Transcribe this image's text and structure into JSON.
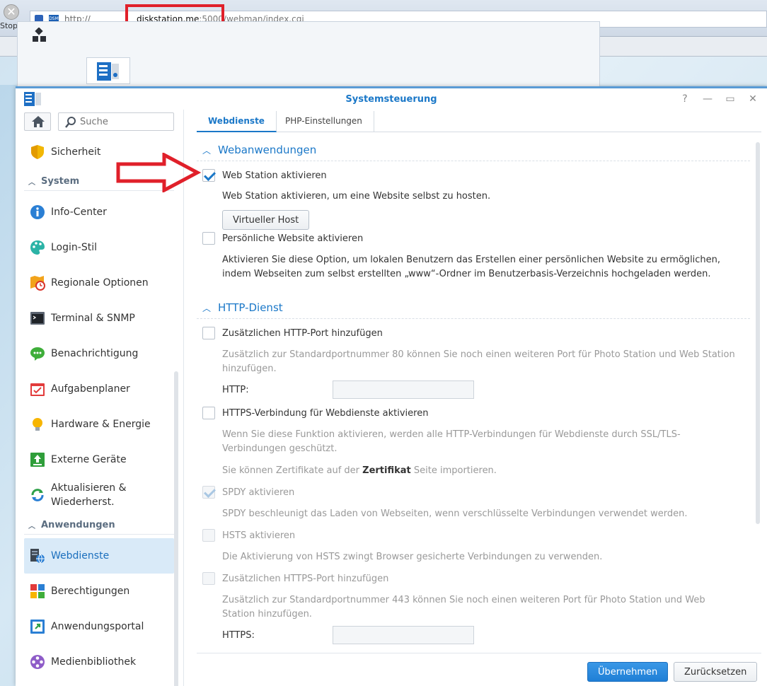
{
  "browser": {
    "stop_label": "Stopp",
    "url_prefix": "http://",
    "url_host": "diskstation.me",
    "url_port": ":5000/",
    "url_path": "webman/index.cgi"
  },
  "window": {
    "title": "Systemsteuerung",
    "help_glyph": "?",
    "minimize_glyph": "—",
    "maximize_glyph": "▭",
    "close_glyph": "✕"
  },
  "sidebar": {
    "search_placeholder": "Suche",
    "items": [
      {
        "label": "Sicherheit",
        "icon": "shield-icon"
      },
      {
        "section": "System"
      },
      {
        "label": "Info-Center",
        "icon": "info-icon"
      },
      {
        "label": "Login-Stil",
        "icon": "palette-icon"
      },
      {
        "label": "Regionale Optionen",
        "icon": "map-clock-icon"
      },
      {
        "label": "Terminal & SNMP",
        "icon": "terminal-icon"
      },
      {
        "label": "Benachrichtigung",
        "icon": "chat-bubble-icon"
      },
      {
        "label": "Aufgabenplaner",
        "icon": "calendar-check-icon"
      },
      {
        "label": "Hardware & Energie",
        "icon": "lightbulb-icon"
      },
      {
        "label": "Externe Geräte",
        "icon": "upload-icon"
      },
      {
        "label": "Aktualisieren & Wiederherst.",
        "icon": "refresh-icon"
      },
      {
        "section": "Anwendungen"
      },
      {
        "label": "Webdienste",
        "icon": "web-services-icon",
        "active": true
      },
      {
        "label": "Berechtigungen",
        "icon": "blocks-icon"
      },
      {
        "label": "Anwendungsportal",
        "icon": "portal-icon"
      },
      {
        "label": "Medienbibliothek",
        "icon": "media-icon"
      }
    ],
    "sections": {
      "system": "System",
      "apps": "Anwendungen"
    }
  },
  "tabs": [
    "Webdienste",
    "PHP-Einstellungen"
  ],
  "webapps": {
    "heading": "Webanwendungen",
    "web_station_label": "Web Station aktivieren",
    "web_station_checked": true,
    "web_station_desc": "Web Station aktivieren, um eine Website selbst zu hosten.",
    "virtual_host_button": "Virtueller Host",
    "personal_label": "Persönliche Website aktivieren",
    "personal_checked": false,
    "personal_desc": "Aktivieren Sie diese Option, um lokalen Benutzern das Erstellen einer persönlichen Website zu ermöglichen, indem Webseiten zum selbst erstellten „www“-Ordner im Benutzerbasis-Verzeichnis hochgeladen werden."
  },
  "http": {
    "heading": "HTTP-Dienst",
    "add_port_label": "Zusätzlichen HTTP-Port hinzufügen",
    "add_port_desc": "Zusätzlich zur Standardportnummer 80 können Sie noch einen weiteren Port für Photo Station und Web Station hinzufügen.",
    "http_field_label": "HTTP:",
    "http_field_value": "",
    "https_label": "HTTPS-Verbindung für Webdienste aktivieren",
    "https_desc": "Wenn Sie diese Funktion aktivieren, werden alle HTTP-Verbindungen für Webdienste durch SSL/TLS-Verbindungen geschützt.",
    "cert_prefix": "Sie können Zertifikate auf der ",
    "cert_bold": "Zertifikat",
    "cert_suffix": " Seite importieren.",
    "spdy_label": "SPDY aktivieren",
    "spdy_desc": "SPDY beschleunigt das Laden von Webseiten, wenn verschlüsselte Verbindungen verwendet werden.",
    "hsts_label": "HSTS aktivieren",
    "hsts_desc": "Die Aktivierung von HSTS zwingt Browser gesicherte Verbindungen zu verwenden.",
    "https_port_label": "Zusätzlichen HTTPS-Port hinzufügen",
    "https_port_desc": "Zusätzlich zur Standardportnummer 443 können Sie noch einen weiteren Port für Photo Station und Web Station hinzufügen.",
    "https_field_label": "HTTPS:",
    "https_field_value": ""
  },
  "footer": {
    "apply": "Übernehmen",
    "reset": "Zurücksetzen"
  },
  "colors": {
    "accent": "#1b78c8",
    "annotation": "#e0202a"
  }
}
